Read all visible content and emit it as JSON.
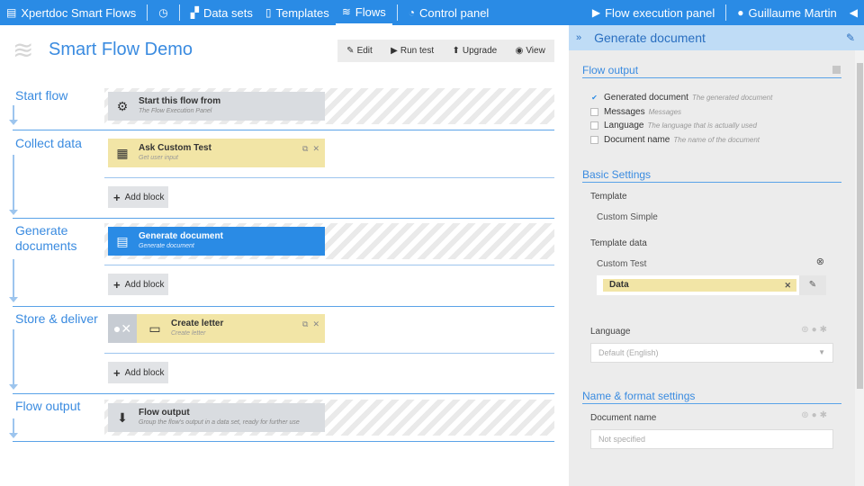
{
  "topbar": {
    "app_title": "Xpertdoc Smart Flows",
    "datasets": "Data sets",
    "templates": "Templates",
    "flows": "Flows",
    "control_panel": "Control panel",
    "execution_panel": "Flow execution panel",
    "user": "Guillaume Martin"
  },
  "page": {
    "title": "Smart Flow Demo",
    "toolbar": {
      "edit": "Edit",
      "run_test": "Run test",
      "upgrade": "Upgrade",
      "view": "View"
    }
  },
  "sections": {
    "start": {
      "title": "Start flow",
      "block_title": "Start this flow from",
      "block_sub": "The Flow Execution Panel"
    },
    "collect": {
      "title": "Collect data",
      "block_title": "Ask Custom Test",
      "block_sub": "Get user input",
      "add": "Add block"
    },
    "generate": {
      "title": "Generate documents",
      "block_title": "Generate document",
      "block_sub": "Generate document",
      "add": "Add block"
    },
    "store": {
      "title": "Store & deliver",
      "block_title": "Create letter",
      "block_sub": "Create letter",
      "add": "Add block"
    },
    "output": {
      "title": "Flow output",
      "block_title": "Flow output",
      "block_sub": "Group the flow's output in a data set, ready for further use"
    }
  },
  "panel": {
    "title": "Generate document",
    "flow_output": {
      "heading": "Flow output",
      "items": [
        {
          "label": "Generated document",
          "desc": "The generated document",
          "checked": true
        },
        {
          "label": "Messages",
          "desc": "Messages",
          "checked": false
        },
        {
          "label": "Language",
          "desc": "The language that is actually used",
          "checked": false
        },
        {
          "label": "Document name",
          "desc": "The name of the document",
          "checked": false
        }
      ]
    },
    "basic": {
      "heading": "Basic Settings",
      "template_label": "Template",
      "template_value": "Custom Simple",
      "template_data_label": "Template data",
      "custom_test_label": "Custom Test",
      "data_tag": "Data",
      "language_label": "Language",
      "language_placeholder": "Default (English)"
    },
    "name_format": {
      "heading": "Name & format settings",
      "doc_name_label": "Document name",
      "doc_name_placeholder": "Not specified"
    }
  },
  "colors": {
    "accent": "#2a8be5",
    "yellow_block": "#f2e5a6",
    "panel_bg": "#ececec"
  },
  "icons": [
    "file-icon",
    "clock-icon",
    "datasets-icon",
    "templates-icon",
    "flows-icon",
    "gauge-icon",
    "play-icon",
    "user-icon",
    "megaphone-icon",
    "pencil-icon",
    "link-icon"
  ]
}
